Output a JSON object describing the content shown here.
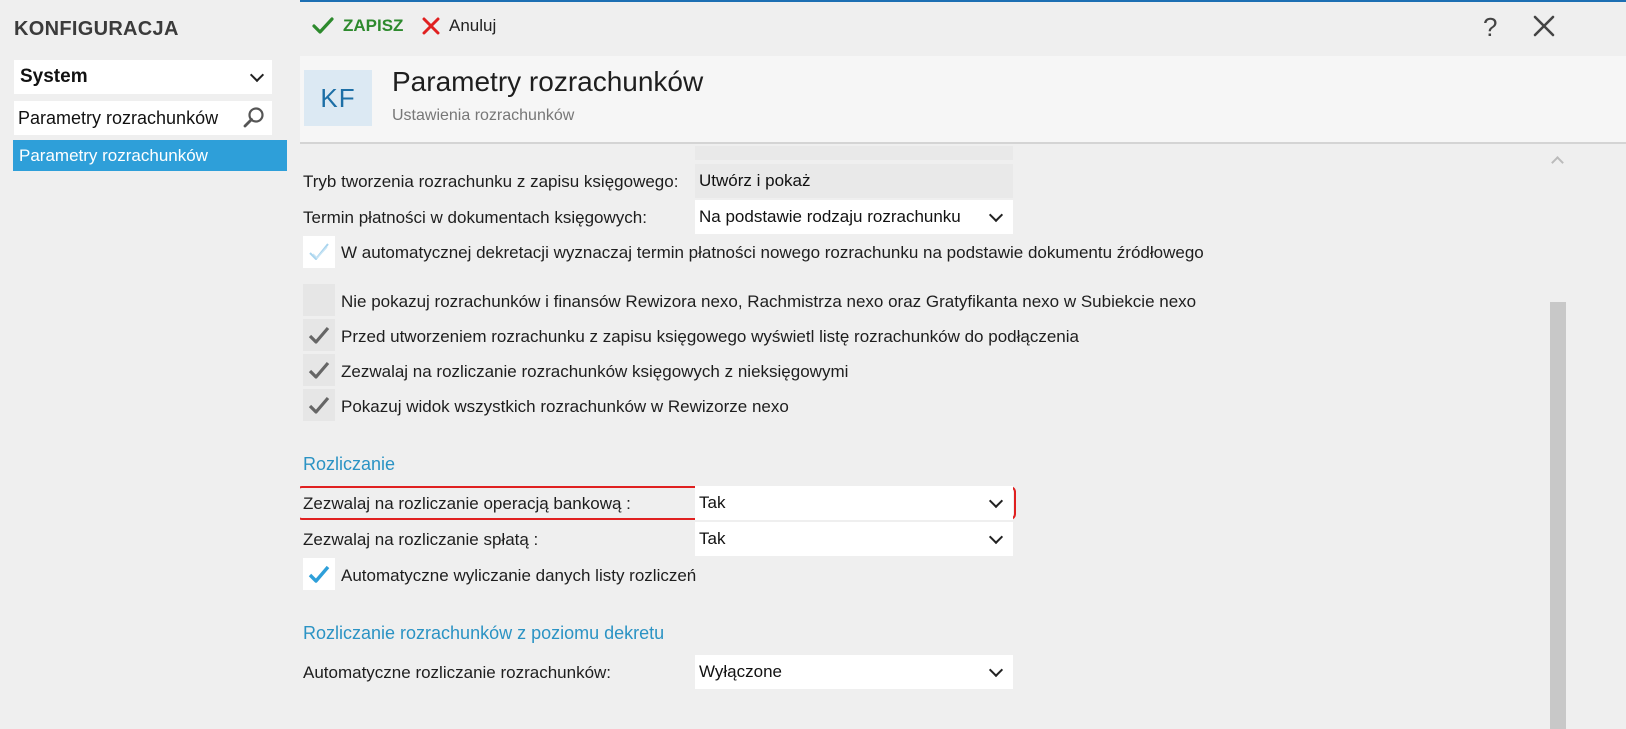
{
  "sidebar": {
    "title": "KONFIGURACJA",
    "module_select": "System",
    "search_value": "Parametry rozrachunków",
    "items": [
      {
        "label": "Parametry rozrachunków",
        "selected": true
      }
    ]
  },
  "toolbar": {
    "save_label": "ZAPISZ",
    "cancel_label": "Anuluj",
    "help_label": "?"
  },
  "header": {
    "badge": "KF",
    "title": "Parametry rozrachunków",
    "subtitle": "Ustawienia rozrachunków"
  },
  "settings": {
    "tryb_label": "Tryb tworzenia rozrachunku z zapisu księgowego:",
    "tryb_value": "Utwórz i pokaż",
    "termin_label": "Termin płatności w dokumentach księgowych:",
    "termin_value": "Na podstawie rodzaju rozrachunku",
    "checkboxes": [
      {
        "label": "W automatycznej dekretacji wyznaczaj termin płatności nowego rozrachunku na podstawie dokumentu źródłowego",
        "state": "checked-disabled"
      },
      {
        "label": "Nie pokazuj rozrachunków i finansów Rewizora nexo, Rachmistrza nexo oraz Gratyfikanta nexo w Subiekcie nexo",
        "state": "unchecked"
      },
      {
        "label": "Przed utworzeniem rozrachunku z zapisu księgowego wyświetl listę rozrachunków do podłączenia",
        "state": "checked"
      },
      {
        "label": "Zezwalaj na rozliczanie rozrachunków księgowych z nieksięgowymi",
        "state": "checked"
      },
      {
        "label": "Pokazuj widok wszystkich rozrachunków w Rewizorze nexo",
        "state": "checked"
      }
    ]
  },
  "rozliczanie": {
    "section_title": "Rozliczanie",
    "bank_label": "Zezwalaj na rozliczanie operacją bankową :",
    "bank_value": "Tak",
    "splata_label": "Zezwalaj na rozliczanie spłatą :",
    "splata_value": "Tak",
    "auto_label": "Automatyczne wyliczanie danych listy rozliczeń",
    "auto_state": "checked"
  },
  "dekret": {
    "section_title": "Rozliczanie rozrachunków z poziomu dekretu",
    "auto_label": "Automatyczne rozliczanie rozrachunków:",
    "auto_value": "Wyłączone"
  },
  "colors": {
    "accent": "#2e9fd9",
    "section": "#2b93c4",
    "save_green": "#2d8a2d",
    "cancel_red": "#e02020",
    "highlight": "#e02020"
  }
}
